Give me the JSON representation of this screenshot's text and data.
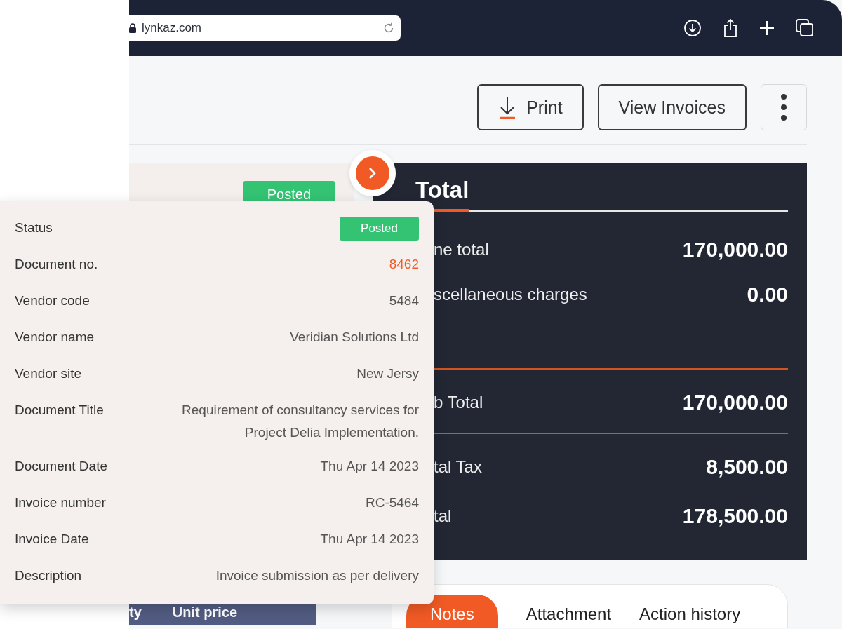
{
  "browser": {
    "url": "lynkaz.com"
  },
  "toolbar": {
    "buttons": [
      {
        "label": "Print",
        "kind": "icon"
      },
      {
        "label": "View Invoices",
        "kind": "plain"
      }
    ]
  },
  "background_card": {
    "status": "Posted"
  },
  "totals": {
    "title": "Total",
    "rows": [
      {
        "label": "ne total",
        "value": "170,000.00",
        "divider": false
      },
      {
        "label": "scellaneous charges",
        "value": "0.00",
        "divider": true
      },
      {
        "label": "b Total",
        "value": "170,000.00",
        "divider": true
      },
      {
        "label": "tal Tax",
        "value": "8,500.00",
        "divider": false
      },
      {
        "label": "tal",
        "value": "178,500.00",
        "divider": false
      }
    ]
  },
  "details": [
    {
      "label": "Status",
      "value": "Posted",
      "kind": "badge"
    },
    {
      "label": "Document no.",
      "value": "8462",
      "kind": "link"
    },
    {
      "label": "Vendor code",
      "value": "5484",
      "kind": "text"
    },
    {
      "label": "Vendor name",
      "value": "Veridian Solutions Ltd",
      "kind": "text"
    },
    {
      "label": "Vendor site",
      "value": "New Jersy",
      "kind": "text"
    },
    {
      "label": "Document Title",
      "value": "Requirement of consultancy services for Project Delia Implementation.",
      "kind": "text"
    },
    {
      "label": "Document Date",
      "value": "Thu Apr 14 2023",
      "kind": "text"
    },
    {
      "label": "Invoice number",
      "value": "RC-5464",
      "kind": "text"
    },
    {
      "label": "Invoice Date",
      "value": "Thu Apr 14 2023",
      "kind": "text"
    },
    {
      "label": "Description",
      "value": "Invoice submission as per delivery",
      "kind": "text"
    }
  ],
  "table": {
    "columns": [
      "ty",
      "Unit price"
    ]
  },
  "tabs": [
    {
      "label": "Notes",
      "selected": true
    },
    {
      "label": "Attachment",
      "selected": false
    },
    {
      "label": "Action history",
      "selected": false
    }
  ]
}
